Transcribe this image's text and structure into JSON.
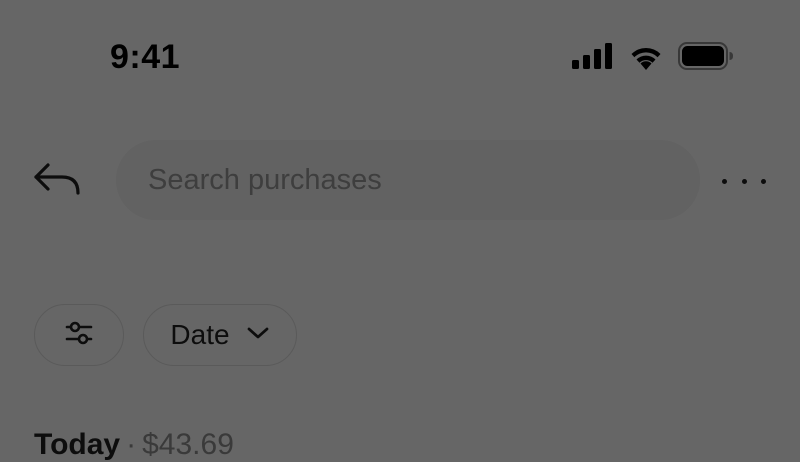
{
  "status_bar": {
    "time": "9:41",
    "icons": [
      "cellular-signal-icon",
      "wifi-icon",
      "battery-icon"
    ]
  },
  "header": {
    "back_icon": "back-arrow-icon",
    "search": {
      "placeholder": "Search purchases",
      "value": ""
    },
    "more_icon": "more-horizontal-icon"
  },
  "filters": {
    "filter_icon": "sliders-icon",
    "date_label": "Date",
    "date_icon": "chevron-down-icon"
  },
  "section": {
    "title": "Today",
    "separator": "·",
    "amount": "$43.69"
  },
  "colors": {
    "background": "#666666",
    "search_fill": "#626262",
    "text": "#0d0d0d"
  }
}
